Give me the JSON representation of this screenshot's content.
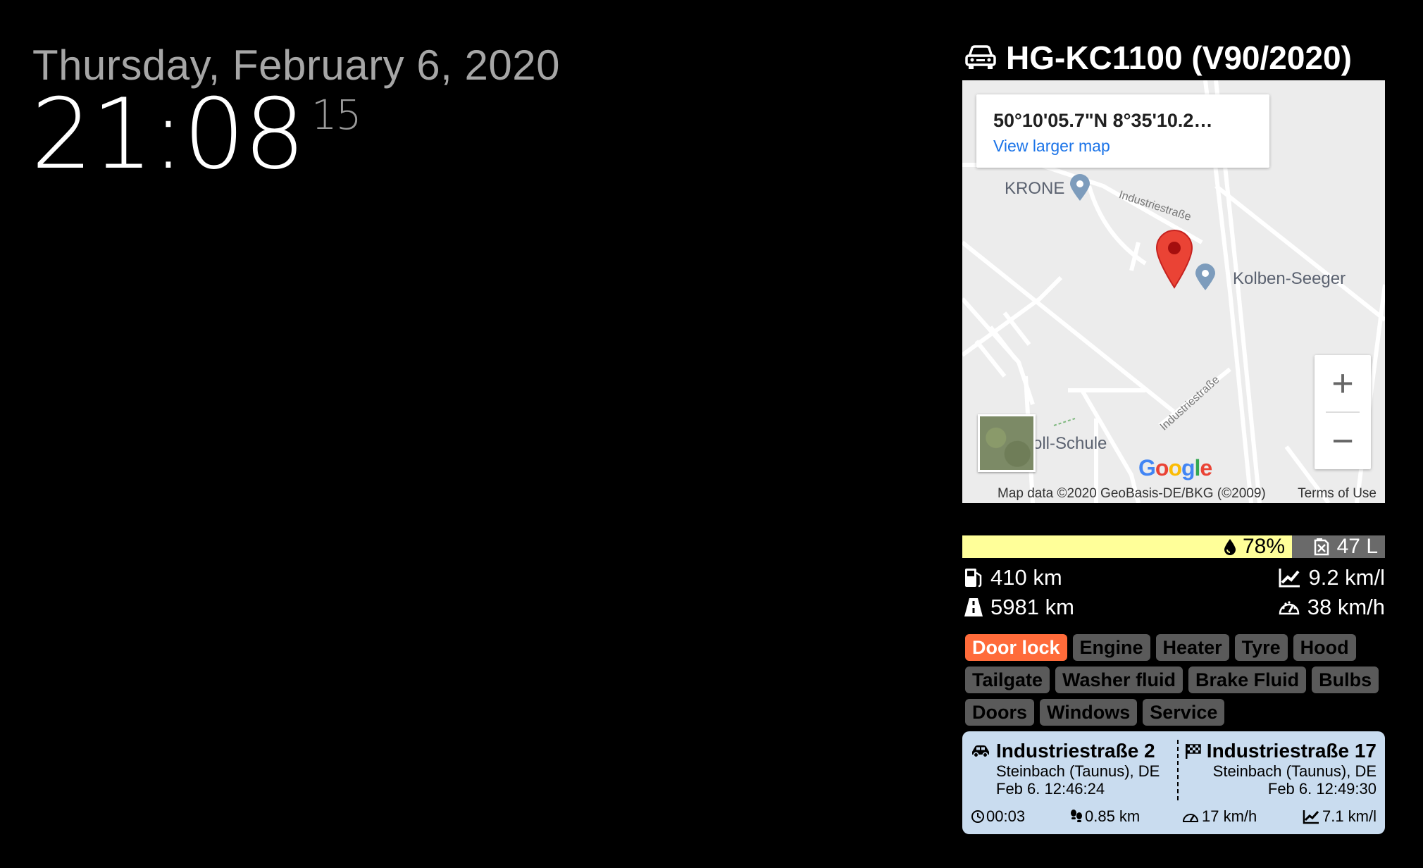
{
  "clock": {
    "date": "Thursday, February 6, 2020",
    "time": "21:08",
    "seconds": "15"
  },
  "car": {
    "title": "HG-KC1100 (V90/2020)",
    "icon": "car-icon"
  },
  "map": {
    "coords": "50°10'05.7\"N 8°35'10.2…",
    "larger_map_link": "View larger map",
    "places": [
      "KRONE",
      "Kolben-Seeger",
      "oll-Schule"
    ],
    "streets": [
      "Industriestraße",
      "Industriestraße"
    ],
    "logo": "Google",
    "attribution": "Map data ©2020 GeoBasis-DE/BKG (©2009)",
    "terms": "Terms of Use",
    "zoom_in": "+",
    "zoom_out": "−"
  },
  "fuel": {
    "level_percent": 78,
    "percent_label": "78%",
    "liters_label": "47 L",
    "range": "410 km",
    "odometer": "5981 km",
    "consumption": "9.2 km/l",
    "avg_speed": "38 km/h",
    "bar_color": "#ffff99"
  },
  "status_badges": {
    "row1": [
      "Door lock",
      "Engine",
      "Heater",
      "Tyre",
      "Hood"
    ],
    "row2": [
      "Tailgate",
      "Washer fluid",
      "Brake Fluid",
      "Bulbs"
    ],
    "row3": [
      "Doors",
      "Windows",
      "Service"
    ],
    "alert_color": "#ff6b3a"
  },
  "trip": {
    "start": {
      "street": "Industriestraße 2",
      "city": "Steinbach (Taunus), DE",
      "time": "Feb 6. 12:46:24"
    },
    "end": {
      "street": "Industriestraße 17",
      "city": "Steinbach (Taunus), DE",
      "time": "Feb 6. 12:49:30"
    },
    "duration": "00:03",
    "distance": "0.85 km",
    "speed": "17 km/h",
    "consumption": "7.1 km/l"
  }
}
